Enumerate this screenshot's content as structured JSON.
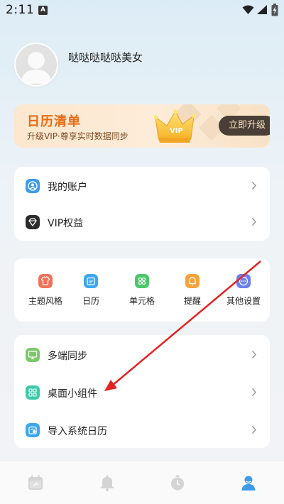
{
  "status_bar": {
    "time": "2:11",
    "notification_icon": "A"
  },
  "profile": {
    "username": "哒哒哒哒哒美女",
    "avatar_icon": "default-avatar-icon"
  },
  "vip_banner": {
    "title": "日历清单",
    "subtitle": "升级VIP·尊享实时数据同步",
    "crown_text": "VIP",
    "upgrade_button": "立即升级"
  },
  "account_section": {
    "items": [
      {
        "label": "我的账户",
        "icon": "user-account-icon",
        "color": "#3d9be9"
      },
      {
        "label": "VIP权益",
        "icon": "vip-diamond-icon",
        "color": "#2b2b2b"
      }
    ]
  },
  "settings_grid": {
    "items": [
      {
        "label": "主题风格",
        "icon": "tshirt-icon",
        "color": "#f07158"
      },
      {
        "label": "日历",
        "icon": "calendar-icon",
        "color": "#3da7ee"
      },
      {
        "label": "单元格",
        "icon": "cells-icon",
        "color": "#4cc76a"
      },
      {
        "label": "提醒",
        "icon": "bell-icon",
        "color": "#f8a23a"
      },
      {
        "label": "其他设置",
        "icon": "more-icon",
        "color": "#6c7ff1"
      }
    ]
  },
  "tools_section": {
    "items": [
      {
        "label": "多端同步",
        "icon": "sync-monitor-icon",
        "color": "#7cc96a"
      },
      {
        "label": "桌面小组件",
        "icon": "widget-icon",
        "color": "#3dc9a8"
      },
      {
        "label": "导入系统日历",
        "icon": "import-calendar-icon",
        "color": "#3da7ee"
      }
    ]
  },
  "bottom_nav": {
    "items": [
      {
        "icon": "calendar-tab-icon",
        "active": false
      },
      {
        "icon": "bell-tab-icon",
        "active": false
      },
      {
        "icon": "timer-tab-icon",
        "active": false
      },
      {
        "icon": "profile-tab-icon",
        "active": true
      }
    ],
    "active_color": "#3d9be9",
    "inactive_color": "#d4d4d4"
  },
  "annotation": {
    "arrow_color": "#e32222"
  }
}
